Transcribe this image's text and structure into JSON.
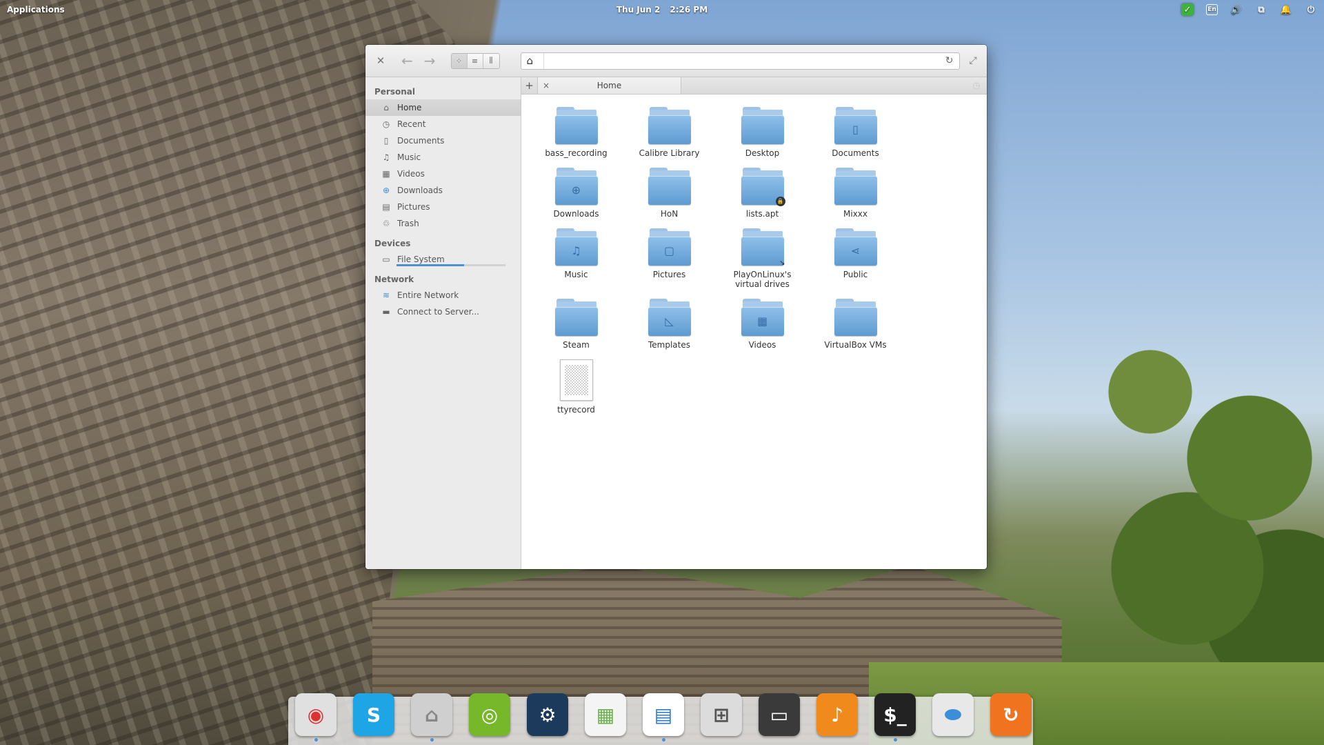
{
  "panel": {
    "applications": "Applications",
    "date": "Thu Jun  2",
    "time": "2:26 PM",
    "lang": "En"
  },
  "window": {
    "nav": {
      "back": "←",
      "forward": "→"
    },
    "location": {
      "value": ""
    },
    "tab": {
      "add": "+",
      "close": "×",
      "label": "Home"
    }
  },
  "sidebar": {
    "sections": [
      {
        "heading": "Personal",
        "items": [
          {
            "label": "Home",
            "icon": "home-icon",
            "glyph": "⌂",
            "selected": true
          },
          {
            "label": "Recent",
            "icon": "clock-icon",
            "glyph": "◷"
          },
          {
            "label": "Documents",
            "icon": "document-icon",
            "glyph": "▯"
          },
          {
            "label": "Music",
            "icon": "music-icon",
            "glyph": "♫"
          },
          {
            "label": "Videos",
            "icon": "film-icon",
            "glyph": "▦"
          },
          {
            "label": "Downloads",
            "icon": "download-icon",
            "glyph": "⊕"
          },
          {
            "label": "Pictures",
            "icon": "picture-icon",
            "glyph": "▤"
          },
          {
            "label": "Trash",
            "icon": "trash-icon",
            "glyph": "♲"
          }
        ]
      },
      {
        "heading": "Devices",
        "items": [
          {
            "label": "File System",
            "icon": "drive-icon",
            "glyph": "▭",
            "usage": 0.62
          }
        ]
      },
      {
        "heading": "Network",
        "items": [
          {
            "label": "Entire Network",
            "icon": "network-icon",
            "glyph": "≋"
          },
          {
            "label": "Connect to Server...",
            "icon": "monitor-icon",
            "glyph": "▬"
          }
        ]
      }
    ]
  },
  "files": [
    {
      "name": "bass_recording",
      "kind": "folder"
    },
    {
      "name": "Calibre Library",
      "kind": "folder"
    },
    {
      "name": "Desktop",
      "kind": "folder"
    },
    {
      "name": "Documents",
      "kind": "folder",
      "glyph": "▯"
    },
    {
      "name": "Downloads",
      "kind": "folder",
      "glyph": "⊕"
    },
    {
      "name": "HoN",
      "kind": "folder"
    },
    {
      "name": "lists.apt",
      "kind": "folder",
      "emblem": "lock"
    },
    {
      "name": "Mixxx",
      "kind": "folder"
    },
    {
      "name": "Music",
      "kind": "folder",
      "glyph": "♫"
    },
    {
      "name": "Pictures",
      "kind": "folder",
      "glyph": "▢"
    },
    {
      "name": "PlayOnLinux's virtual drives",
      "kind": "folder",
      "emblem": "link"
    },
    {
      "name": "Public",
      "kind": "folder",
      "glyph": "⋖"
    },
    {
      "name": "Steam",
      "kind": "folder"
    },
    {
      "name": "Templates",
      "kind": "folder",
      "glyph": "◺"
    },
    {
      "name": "Videos",
      "kind": "folder",
      "glyph": "▦"
    },
    {
      "name": "VirtualBox VMs",
      "kind": "folder"
    },
    {
      "name": "ttyrecord",
      "kind": "file"
    }
  ],
  "dock": [
    {
      "name": "chrome-icon",
      "bg": "#e0e0e0",
      "glyph": "◉",
      "color": "#d33",
      "running": true
    },
    {
      "name": "skype-icon",
      "bg": "#1ea5e6",
      "glyph": "S",
      "color": "#fff",
      "running": false
    },
    {
      "name": "files-icon",
      "bg": "#cfcfcf",
      "glyph": "⌂",
      "color": "#888",
      "running": true
    },
    {
      "name": "nvidia-icon",
      "bg": "#76b82a",
      "glyph": "◎",
      "color": "#fff",
      "running": false
    },
    {
      "name": "steam-icon",
      "bg": "#1b3a5c",
      "glyph": "⚙",
      "color": "#fff",
      "running": false
    },
    {
      "name": "calendar-icon",
      "bg": "#f4f4f4",
      "glyph": "▦",
      "color": "#6ab04c",
      "running": false
    },
    {
      "name": "writer-icon",
      "bg": "#ffffff",
      "glyph": "▤",
      "color": "#2e7bc4",
      "running": true
    },
    {
      "name": "calculator-icon",
      "bg": "#dcdcdc",
      "glyph": "⊞",
      "color": "#555",
      "running": false
    },
    {
      "name": "screenshot-icon",
      "bg": "#3a3a3a",
      "glyph": "▭",
      "color": "#fff",
      "running": false
    },
    {
      "name": "music-player-icon",
      "bg": "#f08a1c",
      "glyph": "♪",
      "color": "#fff",
      "running": false
    },
    {
      "name": "terminal-icon",
      "bg": "#222222",
      "glyph": "$_",
      "color": "#fff",
      "running": true
    },
    {
      "name": "settings-switch-icon",
      "bg": "#e8e8e8",
      "glyph": "⬬",
      "color": "#3b8ed8",
      "running": false
    },
    {
      "name": "update-icon",
      "bg": "#f0731f",
      "glyph": "↻",
      "color": "#fff",
      "running": false
    }
  ]
}
